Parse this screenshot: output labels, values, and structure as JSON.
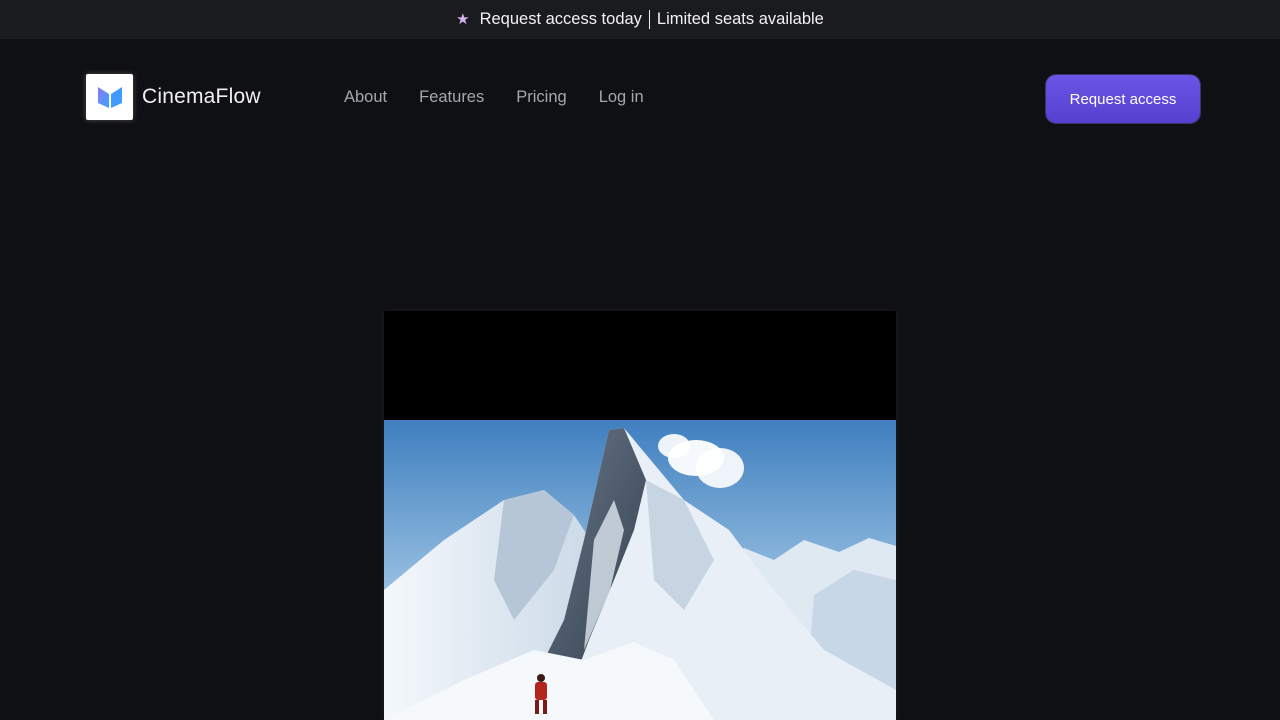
{
  "announcement": {
    "icon": "star-icon",
    "text_left": "Request access today",
    "text_right": "Limited seats available"
  },
  "nav": {
    "brand_name": "CinemaFlow",
    "links": [
      "About",
      "Features",
      "Pricing",
      "Log in"
    ],
    "cta_label": "Request access"
  },
  "colors": {
    "page_bg": "#0f1013",
    "banner_bg": "#1a1b1f",
    "accent": "#5f4ad9",
    "link": "#a6a7ad"
  },
  "hero_media": {
    "icon": "video-player"
  }
}
